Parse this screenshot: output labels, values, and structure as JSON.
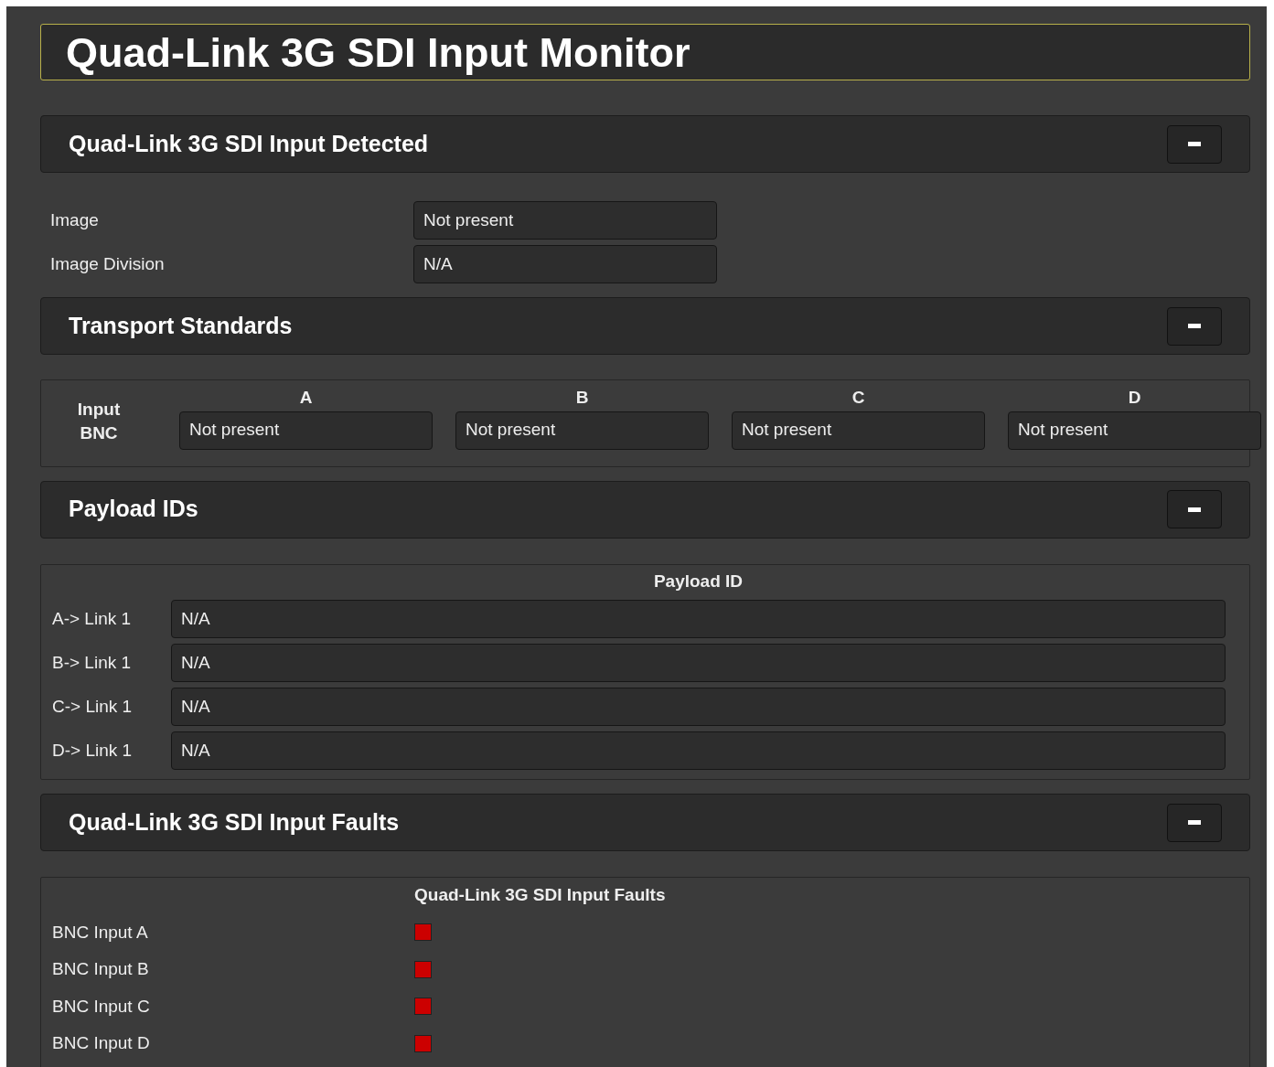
{
  "title": "Quad-Link 3G SDI Input Monitor",
  "sections": [
    {
      "kind": "fields",
      "title": "Quad-Link 3G SDI Input Detected",
      "expanded": true,
      "rows": [
        {
          "label": "Image",
          "value": "Not present"
        },
        {
          "label": "Image Division",
          "value": "N/A"
        }
      ]
    },
    {
      "kind": "bnc_grid",
      "title": "Transport Standards",
      "expanded": true,
      "row_label": "Input BNC",
      "columns": [
        {
          "heading": "A",
          "value": "Not present"
        },
        {
          "heading": "B",
          "value": "Not present"
        },
        {
          "heading": "C",
          "value": "Not present"
        },
        {
          "heading": "D",
          "value": "Not present"
        }
      ]
    },
    {
      "kind": "payload",
      "title": "Payload IDs",
      "expanded": true,
      "heading": "Payload ID",
      "rows": [
        {
          "label": "A-> Link 1",
          "value": "N/A"
        },
        {
          "label": "B-> Link 1",
          "value": "N/A"
        },
        {
          "label": "C-> Link 1",
          "value": "N/A"
        },
        {
          "label": "D-> Link 1",
          "value": "N/A"
        }
      ]
    },
    {
      "kind": "faults",
      "title": "Quad-Link 3G SDI Input Faults",
      "expanded": true,
      "heading": "Quad-Link 3G SDI Input Faults",
      "rows": [
        {
          "label": "BNC Input A",
          "color": "#cc0000"
        },
        {
          "label": "BNC Input B",
          "color": "#cc0000"
        },
        {
          "label": "BNC Input C",
          "color": "#cc0000"
        },
        {
          "label": "BNC Input D",
          "color": "#cc0000"
        }
      ]
    }
  ]
}
